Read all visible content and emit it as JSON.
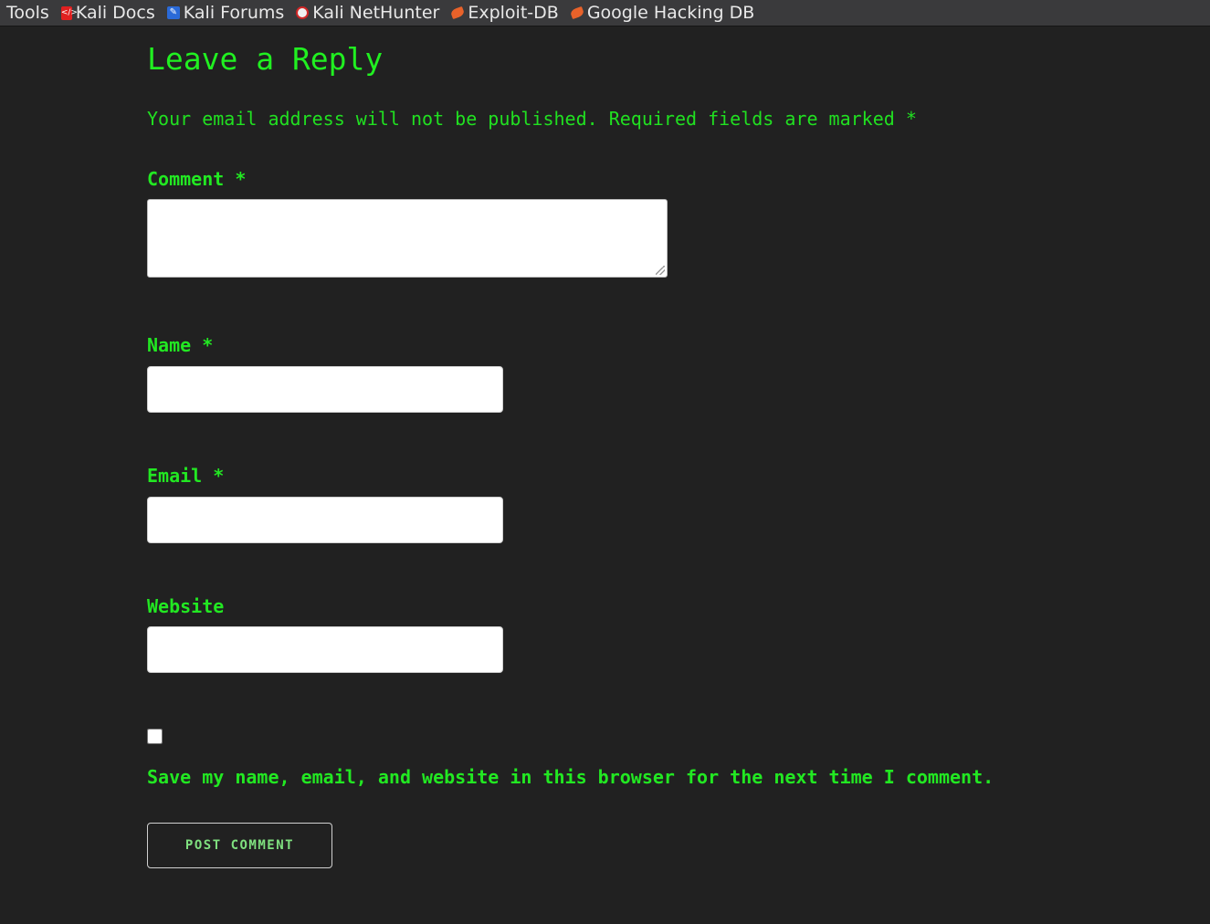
{
  "bookmarks_bar": {
    "items": [
      {
        "label": "Tools",
        "icon": ""
      },
      {
        "label": "Kali Docs",
        "icon": "kali-docs-icon"
      },
      {
        "label": "Kali Forums",
        "icon": "kali-forums-icon"
      },
      {
        "label": "Kali NetHunter",
        "icon": "kali-nethunter-icon"
      },
      {
        "label": "Exploit-DB",
        "icon": "exploit-db-icon"
      },
      {
        "label": "Google Hacking DB",
        "icon": "exploit-db-icon"
      }
    ]
  },
  "reply_form": {
    "title": "Leave a Reply",
    "notes": "Your email address will not be published. Required fields are marked *",
    "comment": {
      "label": "Comment *",
      "value": ""
    },
    "name": {
      "label": "Name *",
      "value": ""
    },
    "email": {
      "label": "Email *",
      "value": ""
    },
    "website": {
      "label": "Website",
      "value": ""
    },
    "consent": {
      "label": "Save my name, email, and website in this browser for the next time I comment.",
      "checked": false
    },
    "submit_label": "POST COMMENT"
  },
  "colors": {
    "background": "#212121",
    "accent_green": "#00ff00",
    "bookmarks_bg": "#3a3a3c"
  }
}
